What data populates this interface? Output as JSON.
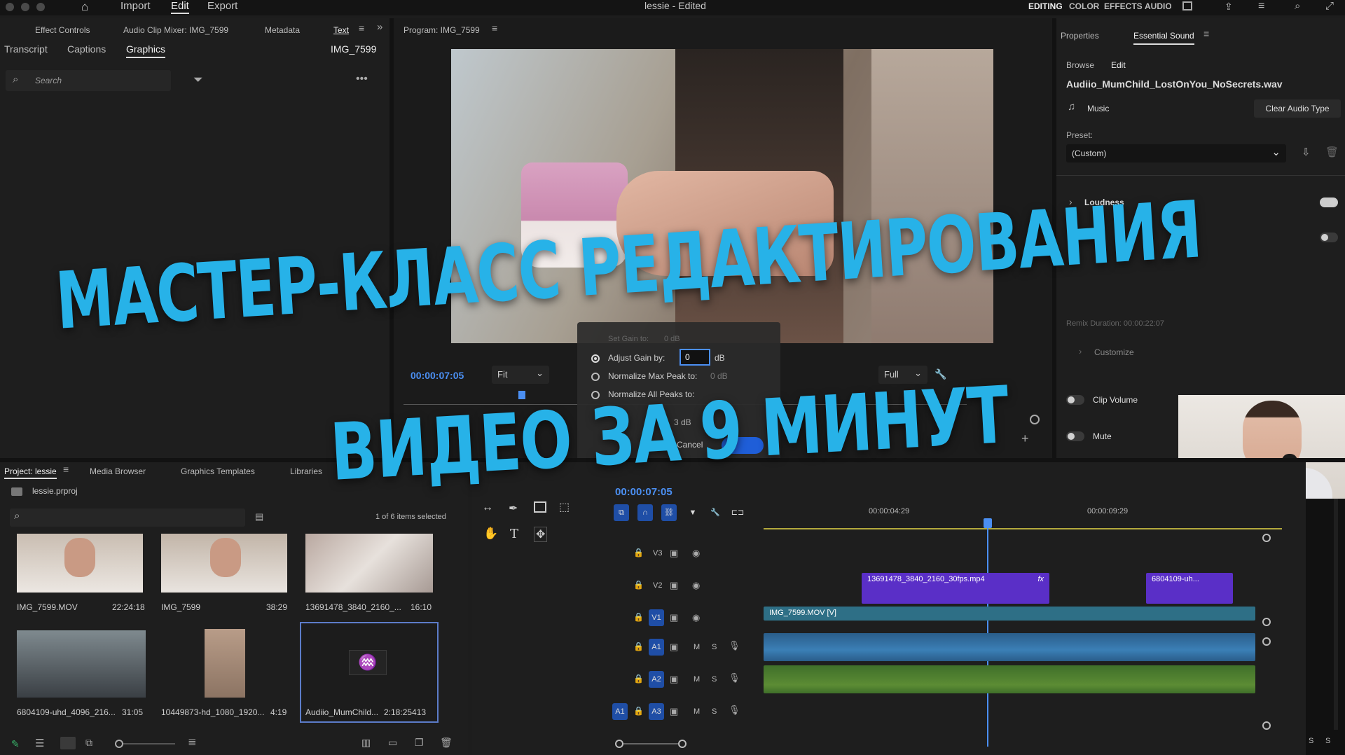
{
  "window": {
    "title": "lessie - Edited"
  },
  "top_menu": {
    "import": "Import",
    "edit": "Edit",
    "export": "Export"
  },
  "workspaces": {
    "editing": "EDITING",
    "color": "COLOR",
    "effects": "EFFECTS",
    "audio": "AUDIO"
  },
  "left_panel": {
    "tabs": [
      "Effect Controls",
      "Audio Clip Mixer: IMG_7599",
      "Metadata",
      "Text"
    ],
    "subtabs": [
      "Transcript",
      "Captions",
      "Graphics"
    ],
    "clip_name": "IMG_7599",
    "search_placeholder": "Search"
  },
  "program": {
    "title": "Program: IMG_7599",
    "timecode": "00:00:07:05",
    "fit": "Fit",
    "quality": "Full"
  },
  "gain_dialog": {
    "set_gain": "Set Gain to:",
    "set_gain_val": "0 dB",
    "adjust_gain": "Adjust Gain by:",
    "adjust_val": "0",
    "adjust_unit": "dB",
    "normalize_max": "Normalize Max Peak to:",
    "normalize_max_val": "0 dB",
    "normalize_all": "Normalize All Peaks to:",
    "amplitude_val": "3 dB",
    "cancel": "Cancel"
  },
  "essential_sound": {
    "tabs": [
      "Properties",
      "Essential Sound"
    ],
    "subtabs": [
      "Browse",
      "Edit"
    ],
    "file": "Audiio_MumChild_LostOnYou_NoSecrets.wav",
    "type": "Music",
    "clear_type": "Clear Audio Type",
    "preset_label": "Preset:",
    "preset_value": "(Custom)",
    "loudness": "Loudness",
    "remix_duration": "Remix Duration: 00:00:22:07",
    "customize": "Customize",
    "clip_volume": "Clip Volume",
    "mute": "Mute"
  },
  "project": {
    "tabs": [
      "Project: lessie",
      "Media Browser",
      "Graphics Templates",
      "Libraries"
    ],
    "file": "lessie.prproj",
    "selection": "1 of 6 items selected",
    "items": [
      {
        "name": "IMG_7599.MOV",
        "duration": "22:24:18"
      },
      {
        "name": "IMG_7599",
        "duration": "38:29"
      },
      {
        "name": "13691478_3840_2160_...",
        "duration": "16:10"
      },
      {
        "name": "6804109-uhd_4096_216...",
        "duration": "31:05"
      },
      {
        "name": "10449873-hd_1080_1920...",
        "duration": "4:19"
      },
      {
        "name": "Audiio_MumChild...",
        "duration": "2:18:25413"
      }
    ]
  },
  "timeline": {
    "timecode": "00:00:07:05",
    "ruler": [
      "00:00:04:29",
      "00:00:09:29"
    ],
    "tracks": {
      "v3": "V3",
      "v2": "V2",
      "v1": "V1",
      "a1": "A1",
      "a2": "A2",
      "a3": "A3",
      "src": "A1",
      "m": "M",
      "s": "S"
    },
    "clips": {
      "v2a": "13691478_3840_2160_30fps.mp4",
      "v2b": "6804109-uh...",
      "v1": "IMG_7599.MOV [V]",
      "fx": "fx"
    }
  },
  "overlay": {
    "line1": "МАСТЕР-КЛАСС РЕДАКТИРОВАНИЯ",
    "line2": "ВИДЕО ЗА 9 МИНУТ"
  },
  "colors": {
    "accent": "#27b2e8",
    "clip_purple": "#5a2fc7",
    "clip_teal": "#2e6f86",
    "audio_blue": "#2a5d8a",
    "audio_green": "#3f6f2a",
    "select": "#1f4ea6"
  }
}
